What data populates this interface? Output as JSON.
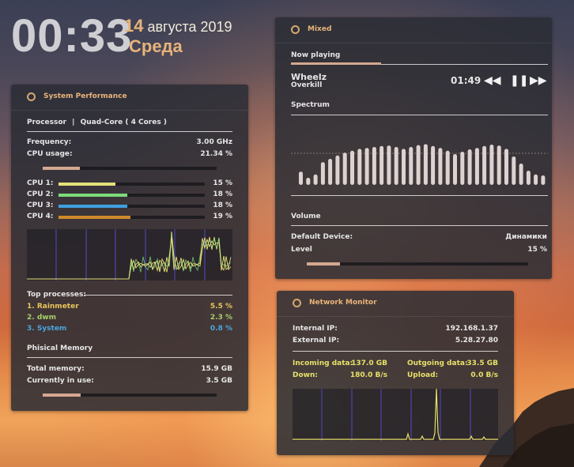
{
  "clock": {
    "time": "00:33",
    "day": "14",
    "month_year": " августа 2019",
    "weekday": "Среда"
  },
  "performance": {
    "title": "System Performance",
    "processor_label": "Processor",
    "separator": "|",
    "processor_desc": "Quad-Core   ( 4  Cores )",
    "frequency_label": "Frequency:",
    "frequency_value": "3.00 GHz",
    "cpu_usage_label": "CPU usage:",
    "cpu_usage_value": "21.34 %",
    "cpu_usage_fraction": 0.2134,
    "cores": [
      {
        "label": "CPU 1:",
        "value": "15 %",
        "fraction": 0.15,
        "color": "#e5e07a"
      },
      {
        "label": "CPU 2:",
        "value": "18 %",
        "fraction": 0.18,
        "color": "#7ddb7a"
      },
      {
        "label": "CPU 3:",
        "value": "18 %",
        "fraction": 0.18,
        "color": "#3fa0e0"
      },
      {
        "label": "CPU 4:",
        "value": "19 %",
        "fraction": 0.19,
        "color": "#d08a2a"
      }
    ],
    "top_processes_label": "Top processes:",
    "processes": [
      {
        "name": "1. Rainmeter",
        "value": "5.5 %",
        "color": "#e8c65a"
      },
      {
        "name": "2. dwm",
        "value": "2.3 %",
        "color": "#a6d06a"
      },
      {
        "name": "3. System",
        "value": "0.8 %",
        "color": "#4aa6e0"
      }
    ],
    "memory_label": "Phisical Memory",
    "total_memory_label": "Total memory:",
    "total_memory_value": "15.9 GB",
    "in_use_label": "Currently in use:",
    "in_use_value": "3.5 GB",
    "memory_fraction": 0.22
  },
  "mixed": {
    "title": "Mixed",
    "now_playing_label": "Now playing",
    "playback_fraction": 0.35,
    "artist": "Wheelz",
    "track": "Overkill",
    "position": "01:49",
    "spectrum_label": "Spectrum",
    "spectrum_levels": [
      0.28,
      0.15,
      0.22,
      0.48,
      0.55,
      0.62,
      0.68,
      0.72,
      0.76,
      0.78,
      0.8,
      0.82,
      0.83,
      0.8,
      0.76,
      0.8,
      0.84,
      0.86,
      0.82,
      0.78,
      0.72,
      0.65,
      0.7,
      0.75,
      0.78,
      0.82,
      0.85,
      0.83,
      0.76,
      0.6,
      0.45,
      0.3,
      0.22,
      0.2
    ],
    "volume_label": "Volume",
    "device_label": "Default Device:",
    "device_value": "Динамики",
    "level_label": "Level",
    "level_value": "15 %",
    "level_fraction": 0.15
  },
  "network": {
    "title": "Network Monitor",
    "internal_ip_label": "Internal IP:",
    "internal_ip": "192.168.1.37",
    "external_ip_label": "External IP:",
    "external_ip": "5.28.27.80",
    "incoming_label": "Incoming data:",
    "incoming_value": "137.0 GB",
    "outgoing_label": "Outgoing data:",
    "outgoing_value": "33.5 GB",
    "down_label": "Down:",
    "down_value": "180.0 B/s",
    "upload_label": "Upload:",
    "upload_value": "0.0 B/s",
    "accent_color": "#e8e06a"
  }
}
